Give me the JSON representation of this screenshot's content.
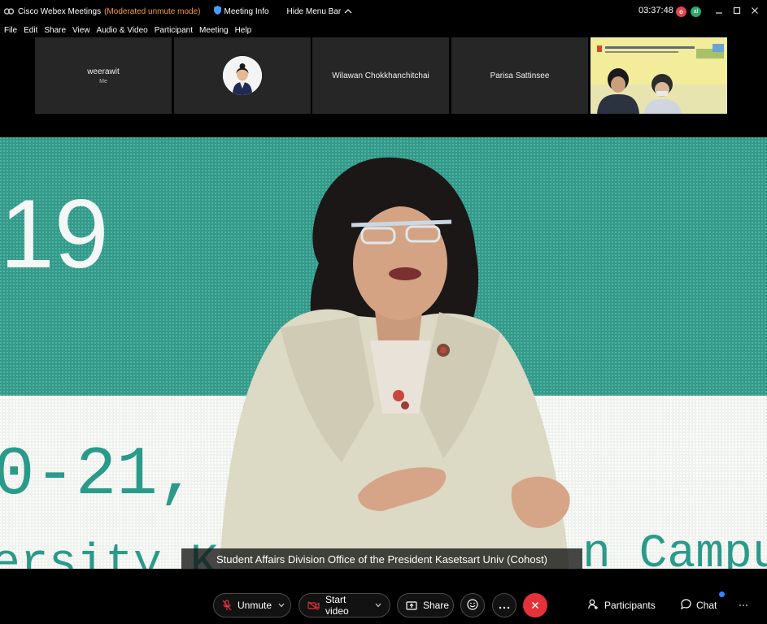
{
  "titlebar": {
    "app_title": "Cisco Webex Meetings",
    "mode": "(Moderated unmute mode)",
    "meeting_info": "Meeting Info",
    "hide_menu": "Hide Menu Bar",
    "clock": "03:37:48",
    "rec_badge": "o",
    "user_badge": "al"
  },
  "menu": [
    "File",
    "Edit",
    "Share",
    "View",
    "Audio & Video",
    "Participant",
    "Meeting",
    "Help"
  ],
  "participants": [
    {
      "name": "weerawit",
      "sub": "Me"
    },
    {
      "name": ""
    },
    {
      "name": "Wilawan Chokkhanchitchai"
    },
    {
      "name": "Parisa Sattinsee"
    },
    {
      "name": ""
    }
  ],
  "stage": {
    "caption": "Student Affairs Division Office of the President Kasetsart Univ (Cohost)",
    "backdrop_text_top": "19",
    "backdrop_text_mid": "0-21, 2",
    "backdrop_text_bottom": "ersity  K",
    "backdrop_text_campus": "n Campus"
  },
  "controls": {
    "unmute": "Unmute",
    "start_video": "Start video",
    "share": "Share",
    "participants": "Participants",
    "chat": "Chat"
  },
  "colors": {
    "accent_orange": "#f39c3b",
    "end_red": "#e5313a",
    "backdrop_teal": "#3aa090"
  }
}
